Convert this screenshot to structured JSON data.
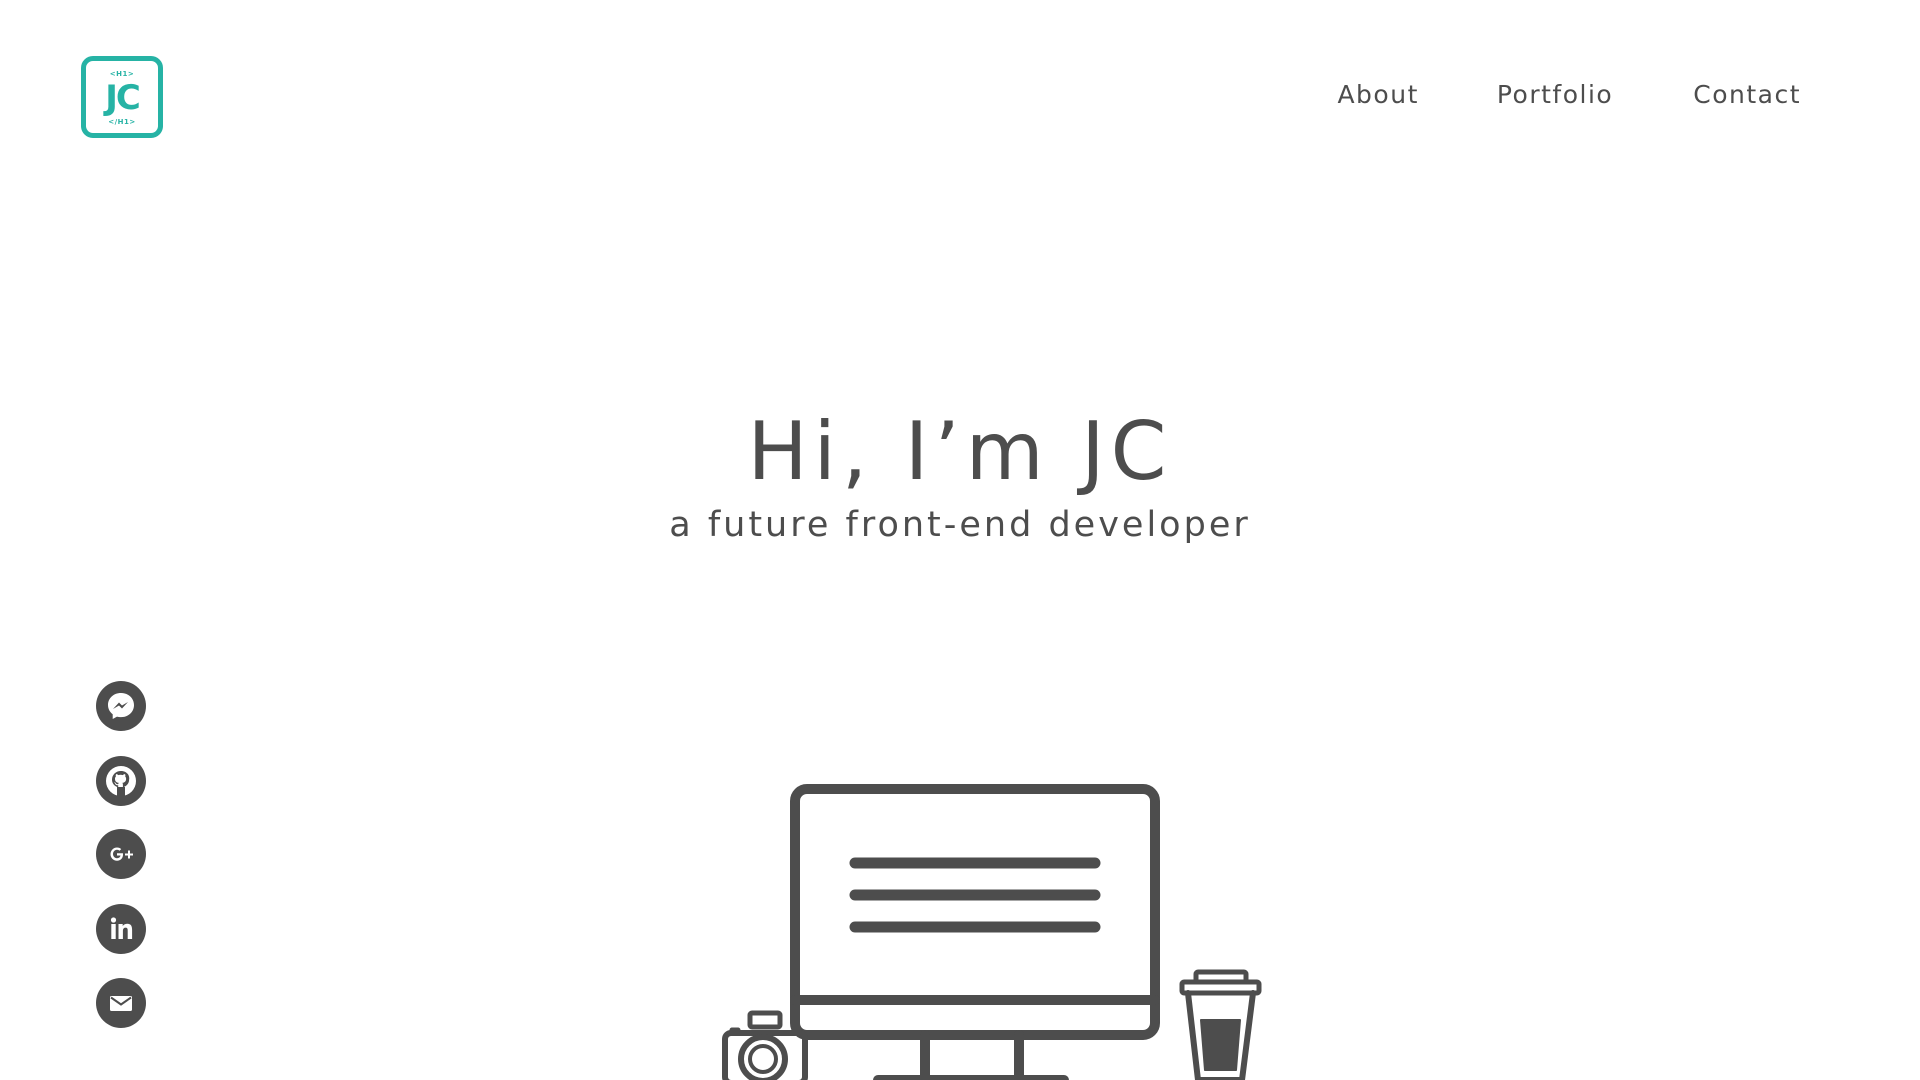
{
  "header": {
    "logo": {
      "initials": "JC",
      "tag_open": "<H1>",
      "tag_close": "</H1>",
      "color": "#26b3a5"
    },
    "nav": [
      {
        "label": "About"
      },
      {
        "label": "Portfolio"
      },
      {
        "label": "Contact"
      }
    ]
  },
  "hero": {
    "title": "Hi, I’m JC",
    "subtitle": "a future front-end developer"
  },
  "social": [
    {
      "icon": "messenger-icon"
    },
    {
      "icon": "github-icon"
    },
    {
      "icon": "google-plus-icon"
    },
    {
      "icon": "linkedin-icon"
    },
    {
      "icon": "email-icon"
    }
  ],
  "colors": {
    "text": "#4d4d4d",
    "accent": "#26b3a5",
    "background": "#ffffff"
  }
}
